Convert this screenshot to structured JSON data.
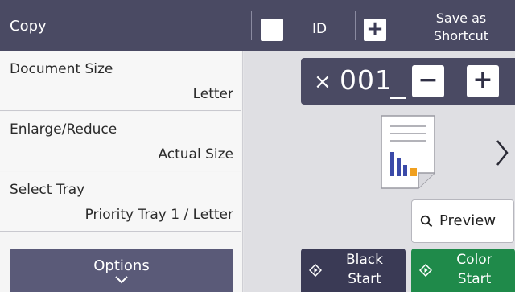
{
  "header": {
    "title": "Copy",
    "id_label": "ID",
    "shortcut_line1": "Save as",
    "shortcut_line2": "Shortcut"
  },
  "settings": [
    {
      "label": "Document Size",
      "value": "Letter"
    },
    {
      "label": "Enlarge/Reduce",
      "value": "Actual Size"
    },
    {
      "label": "Select Tray",
      "value": "Priority Tray 1 / Letter"
    }
  ],
  "options": {
    "label": "Options"
  },
  "copies": {
    "prefix": "×",
    "value": "001",
    "minus": "−",
    "plus": "+"
  },
  "preview": {
    "label": "Preview"
  },
  "black_start": {
    "line1": "Black",
    "line2": "Start"
  },
  "color_start": {
    "line1": "Color",
    "line2": "Start"
  },
  "colors": {
    "header_bg": "#4a4a63",
    "color_start": "#1f8a4a",
    "black_start": "#3a3a55",
    "doc_bar_blue": "#3b4aa8",
    "doc_bar_orange": "#f0a020"
  }
}
